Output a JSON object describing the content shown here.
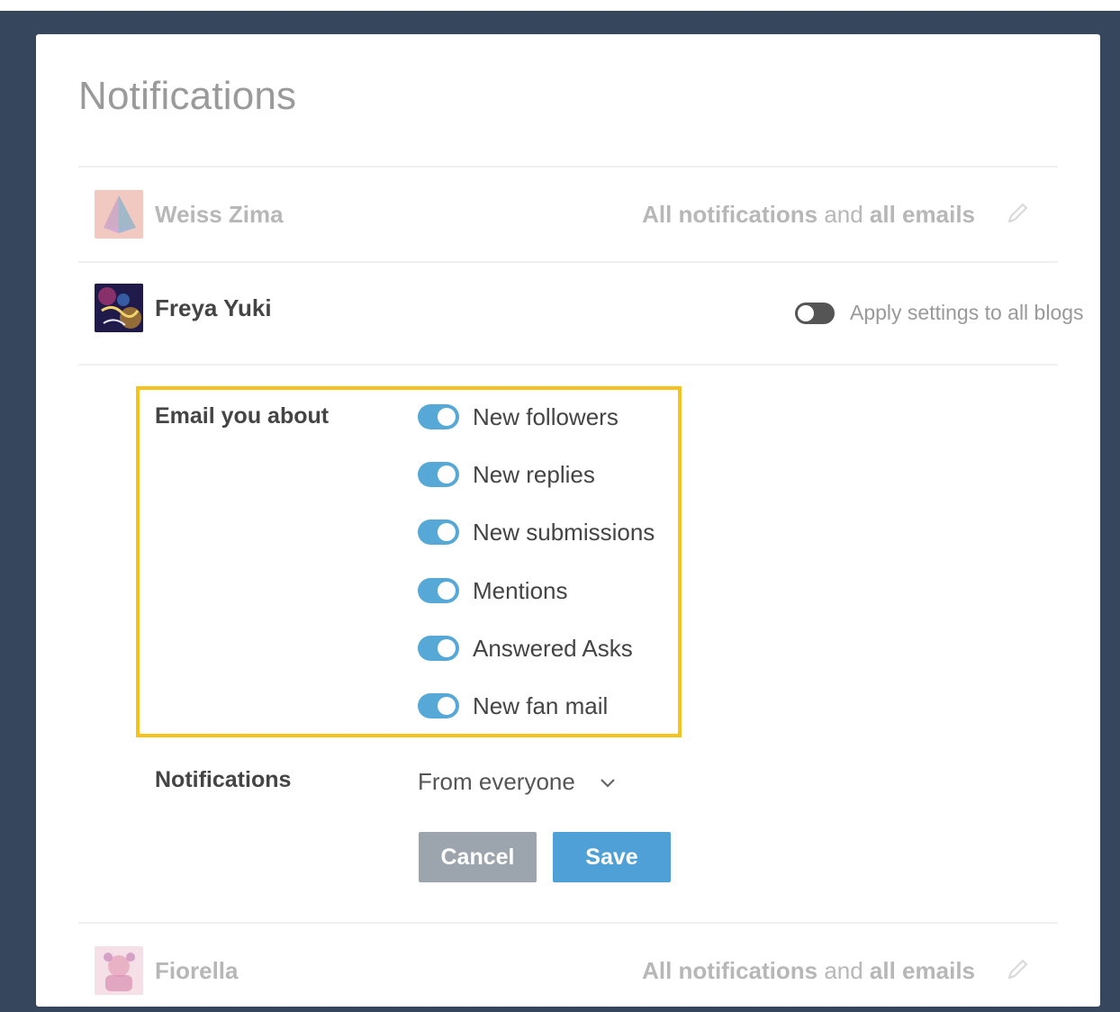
{
  "page": {
    "title": "Notifications"
  },
  "blogs": [
    {
      "name": "Weiss Zima",
      "status_bold_1": "All notifications",
      "status_mid": " and ",
      "status_bold_2": "all emails",
      "avatar_icon": "pyramid-avatar-icon",
      "edit_icon": "pencil-icon"
    },
    {
      "name": "Freya Yuki",
      "apply_label": "Apply settings to all blogs",
      "apply_toggle_on": false,
      "avatar_icon": "freya-yuki-avatar-icon"
    },
    {
      "name": "Fiorella",
      "status_bold_1": "All notifications",
      "status_mid": " and ",
      "status_bold_2": "all emails",
      "avatar_icon": "fiorella-avatar-icon",
      "edit_icon": "pencil-icon"
    }
  ],
  "settings": {
    "email_label": "Email you about",
    "options": [
      {
        "label": "New followers",
        "on": true
      },
      {
        "label": "New replies",
        "on": true
      },
      {
        "label": "New submissions",
        "on": true
      },
      {
        "label": "Mentions",
        "on": true
      },
      {
        "label": "Answered Asks",
        "on": true
      },
      {
        "label": "New fan mail",
        "on": true
      }
    ],
    "notifications_label": "Notifications",
    "notifications_value": "From everyone",
    "cancel_label": "Cancel",
    "save_label": "Save"
  },
  "colors": {
    "background": "#36465d",
    "toggle_on": "#56a8d6",
    "save_button": "#4fa0d6",
    "cancel_button": "#9ca5ad",
    "highlight": "#f7c21b"
  }
}
